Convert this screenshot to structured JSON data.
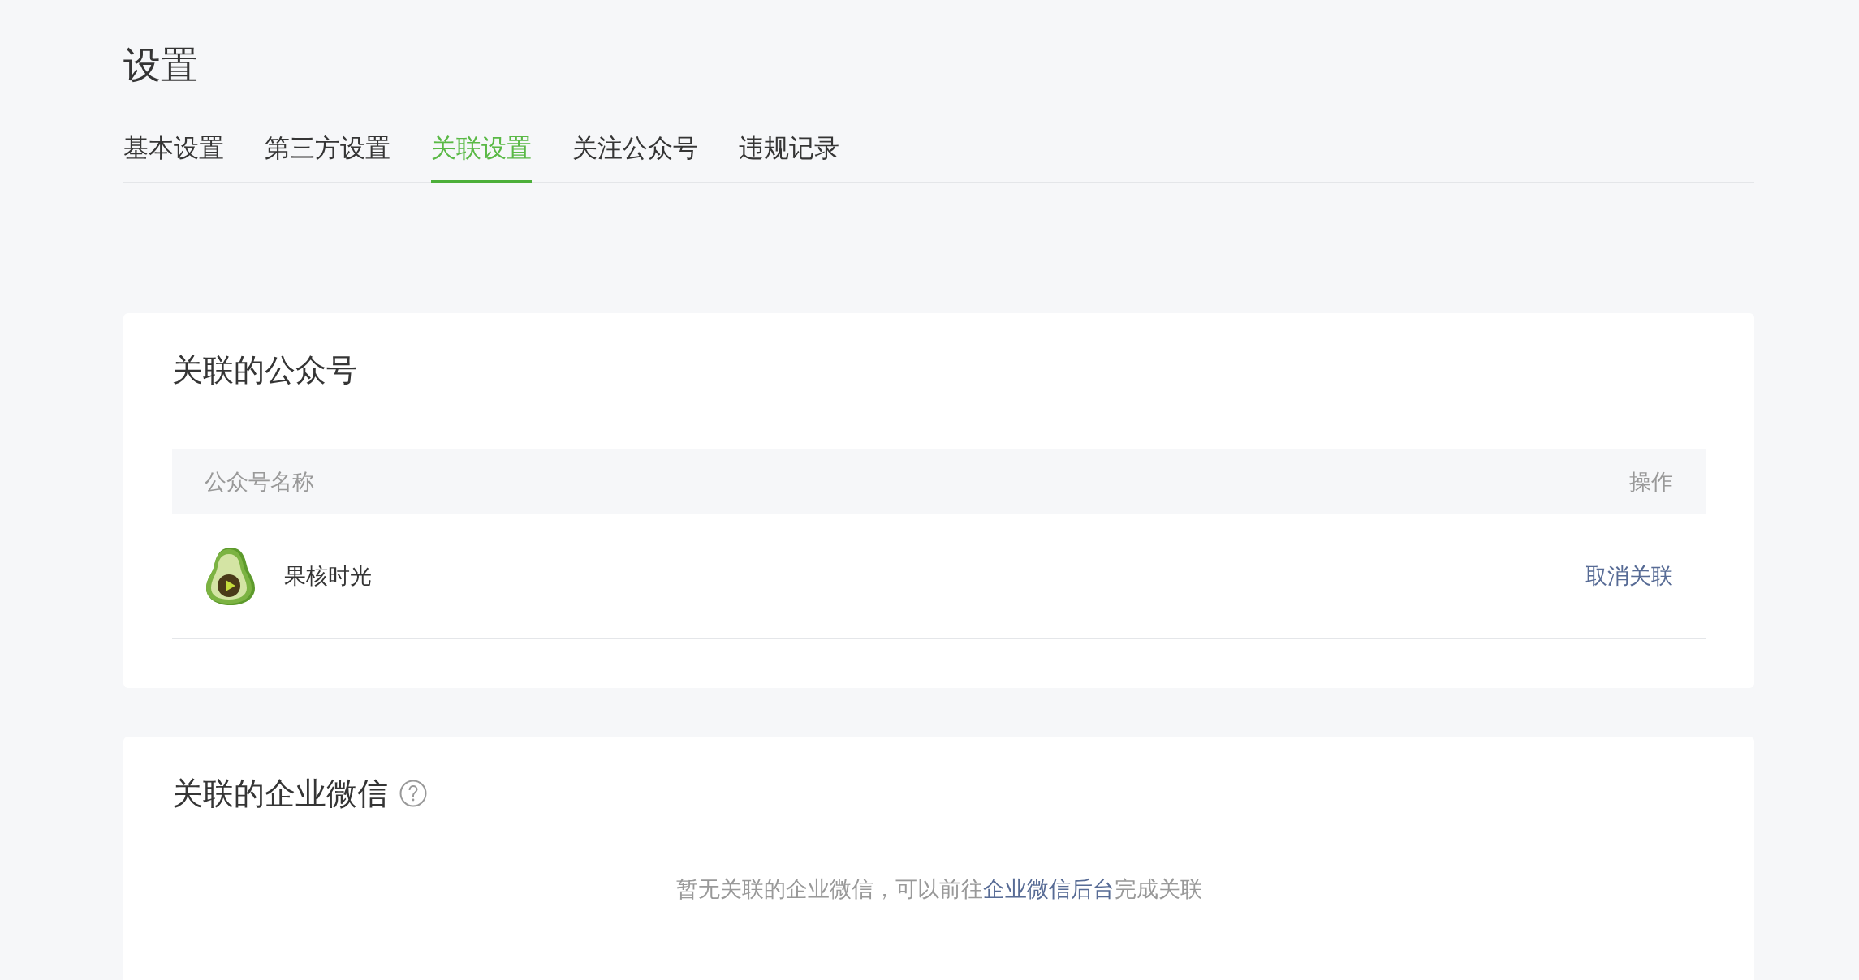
{
  "page": {
    "title": "设置"
  },
  "tabs": [
    {
      "label": "基本设置",
      "selected": false
    },
    {
      "label": "第三方设置",
      "selected": false
    },
    {
      "label": "关联设置",
      "selected": true
    },
    {
      "label": "关注公众号",
      "selected": false
    },
    {
      "label": "违规记录",
      "selected": false
    }
  ],
  "linked_accounts": {
    "title": "关联的公众号",
    "columns": [
      "公众号名称",
      "操作"
    ],
    "rows": [
      {
        "name": "果核时光",
        "action": "取消关联"
      }
    ]
  },
  "linked_wecom": {
    "title": "关联的企业微信",
    "empty_text": {
      "before": "暂无关联的企业微信，可以前往",
      "link": "企业微信后台",
      "after": "完成关联"
    }
  }
}
